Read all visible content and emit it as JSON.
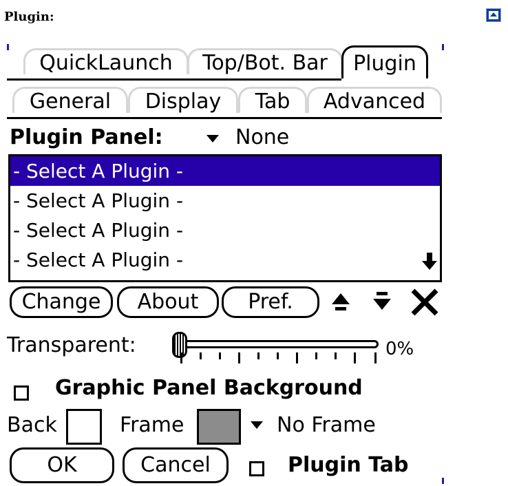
{
  "window": {
    "title": "Plugin:"
  },
  "tabs_row1": [
    {
      "label": "QuickLaunch"
    },
    {
      "label": "Top/Bot. Bar"
    },
    {
      "label": "Plugin",
      "active": true
    }
  ],
  "tabs_row2": [
    {
      "label": "General"
    },
    {
      "label": "Display"
    },
    {
      "label": "Tab"
    },
    {
      "label": "Advanced"
    }
  ],
  "plugin_panel": {
    "label": "Plugin Panel:",
    "value": "None"
  },
  "plugin_list": {
    "items": [
      "- Select A Plugin -",
      "- Select A Plugin -",
      "- Select A Plugin -",
      "- Select A Plugin -"
    ],
    "selected_index": 0
  },
  "buttons": {
    "change": "Change",
    "about": "About",
    "pref": "Pref.",
    "ok": "OK",
    "cancel": "Cancel"
  },
  "transparent": {
    "label": "Transparent:",
    "value_text": "0%",
    "value": 0
  },
  "graphic_bg": {
    "label": "Graphic Panel Background",
    "checked": false
  },
  "colors": {
    "back_label": "Back",
    "back_color": "#ffffff",
    "frame_label": "Frame",
    "frame_color": "#8c8c8c",
    "frame_style": "No Frame",
    "selection": "#2600a8",
    "corner_button": "#0b3f8f"
  },
  "plugin_tab": {
    "label": "Plugin Tab",
    "checked": false
  }
}
